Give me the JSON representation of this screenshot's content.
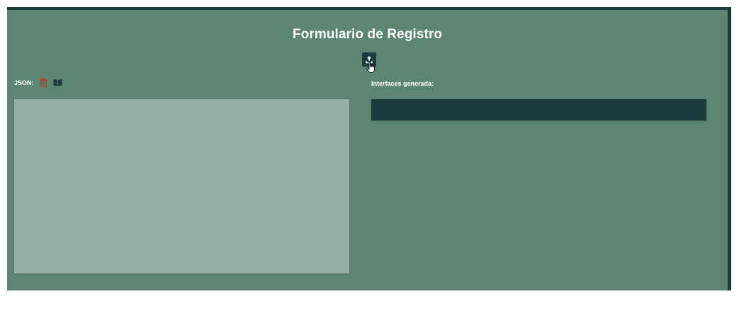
{
  "form": {
    "title": "Formulario de Registro"
  },
  "json_section": {
    "label": "JSON:",
    "delete_icon": "trash-icon",
    "book_icon": "book-open-icon",
    "textarea_value": ""
  },
  "interfaces_section": {
    "label": "Interfaces generada:",
    "output_text": ""
  },
  "upload_icon": "upload-icon",
  "colors": {
    "panel_bg": "#5c8574",
    "dark_accent": "#1b3b3c",
    "textarea_bg": "#94afa5",
    "delete_red": "#c0392b",
    "text": "#ffffff"
  }
}
